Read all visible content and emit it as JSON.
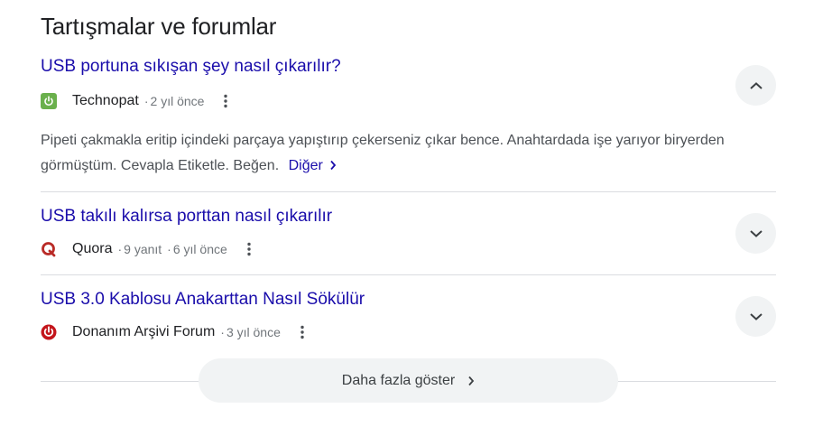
{
  "section": {
    "title": "Tartışmalar ve forumlar"
  },
  "results": [
    {
      "title": "USB portuna sıkışan şey nasıl çıkarılır?",
      "site": "Technopat",
      "answers": "",
      "age": "2 yıl önce",
      "snippet": "Pipeti çakmakla eritip içindeki parçaya yapıştırıp çekerseniz çıkar bence. Anahtardada işe yarıyor biryerden görmüştüm. Cevapla Etiketle. Beğen.",
      "more": "Diğer",
      "expanded": true,
      "favicon": "power-icon",
      "favicon_color": "#6ab04c"
    },
    {
      "title": "USB takılı kalırsa porttan nasıl çıkarılır",
      "site": "Quora",
      "answers": "9 yanıt",
      "age": "6 yıl önce",
      "expanded": false,
      "favicon": "quora-icon",
      "favicon_color": "#b92b27"
    },
    {
      "title": "USB 3.0 Kablosu Anakarttan Nasıl Sökülür",
      "site": "Donanım Arşivi Forum",
      "answers": "",
      "age": "3 yıl önce",
      "expanded": false,
      "favicon": "donanim-power-icon",
      "favicon_color": "#c4161c"
    }
  ],
  "sep": "·",
  "show_more": {
    "label": "Daha fazla göster"
  },
  "colors": {
    "link": "#1a0dab",
    "meta": "#70757a",
    "button_bg": "#f1f3f4"
  }
}
